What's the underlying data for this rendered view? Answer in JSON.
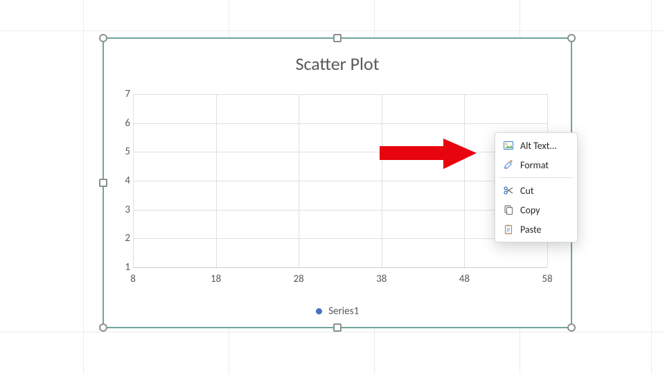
{
  "chart": {
    "title": "Scatter Plot",
    "legend": {
      "series_label": "Series1",
      "swatch_color": "#4472c4"
    },
    "colors": {
      "selection_border": "#6fa59d",
      "grid": "#e0e0e0",
      "text": "#595959"
    }
  },
  "chart_data": {
    "type": "scatter",
    "title": "Scatter Plot",
    "series": [
      {
        "name": "Series1",
        "values": []
      }
    ],
    "xlabel": "",
    "ylabel": "",
    "xlim": [
      8,
      58
    ],
    "ylim": [
      1,
      7
    ],
    "x_ticks": [
      8,
      18,
      28,
      38,
      48,
      58
    ],
    "y_ticks": [
      1,
      2,
      3,
      4,
      5,
      6,
      7
    ],
    "grid": true,
    "legend_position": "bottom"
  },
  "context_menu": {
    "items": [
      {
        "id": "alt-text",
        "label": "Alt Text...",
        "icon": "picture-icon"
      },
      {
        "id": "format",
        "label": "Format",
        "icon": "paint-icon"
      },
      {
        "id": "sep1",
        "separator": true
      },
      {
        "id": "cut",
        "label": "Cut",
        "icon": "scissors-icon"
      },
      {
        "id": "copy",
        "label": "Copy",
        "icon": "copy-icon"
      },
      {
        "id": "paste",
        "label": "Paste",
        "icon": "clipboard-icon"
      }
    ]
  },
  "annotation": {
    "label": "Format",
    "arrow_color": "#e7040f"
  }
}
